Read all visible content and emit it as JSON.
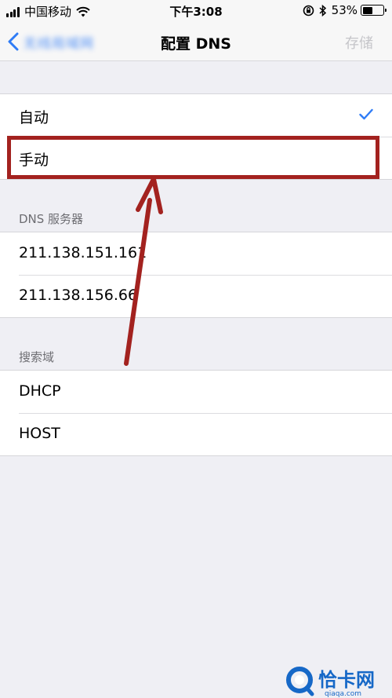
{
  "status_bar": {
    "carrier": "中国移动",
    "time": "下午3:08",
    "battery_percent_text": "53%",
    "battery_level": 0.53
  },
  "nav": {
    "back_label": "无线局域网",
    "title": "配置 DNS",
    "save_label": "存储",
    "accent_color": "#2f7cf6"
  },
  "mode_section": {
    "items": [
      {
        "label": "自动",
        "selected": true
      },
      {
        "label": "手动",
        "selected": false
      }
    ]
  },
  "dns_section": {
    "header": "DNS 服务器",
    "items": [
      "211.138.151.161",
      "211.138.156.66"
    ]
  },
  "search_domain_section": {
    "header": "搜索域",
    "items": [
      "DHCP",
      "HOST"
    ]
  },
  "annotation": {
    "color": "#a3221f",
    "target": "手动"
  },
  "watermark": {
    "text": "恰卡网",
    "url_text": "qiaqa.com",
    "color": "#1668c7"
  }
}
